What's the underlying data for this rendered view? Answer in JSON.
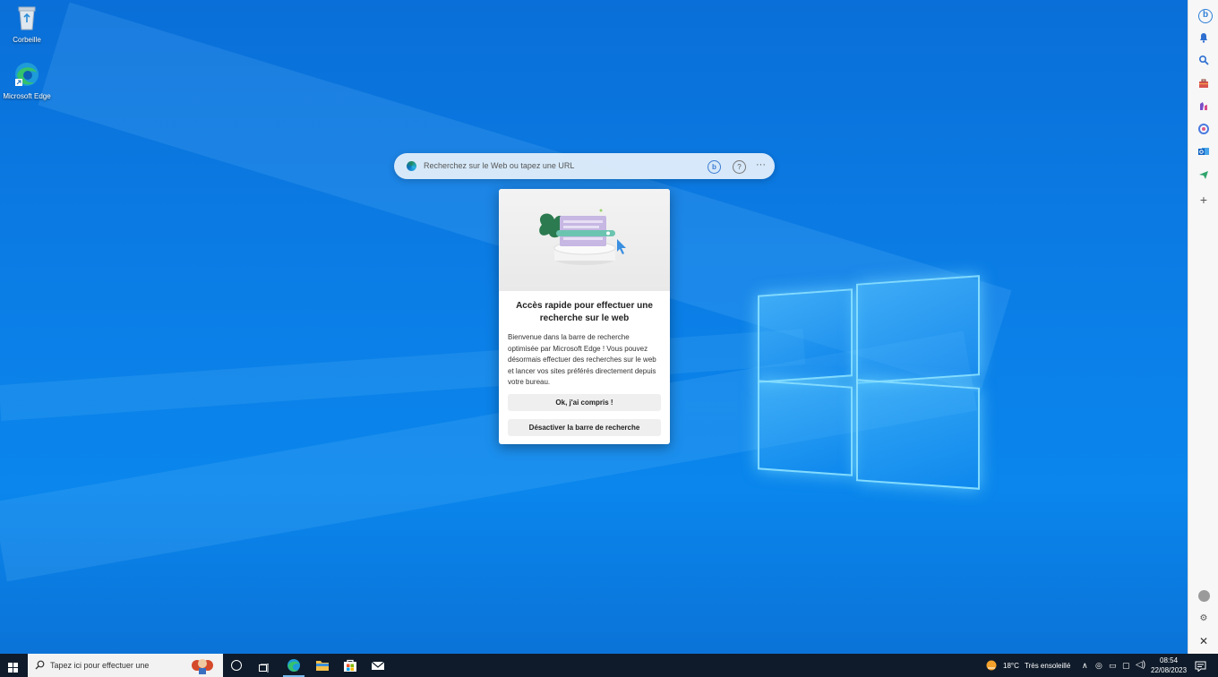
{
  "desktop": {
    "icons": [
      {
        "label": "Corbeille"
      },
      {
        "label": "Microsoft Edge"
      }
    ]
  },
  "searchbar": {
    "placeholder": "Recherchez sur le Web ou tapez une URL"
  },
  "popup": {
    "title": "Accès rapide pour effectuer une recherche sur le web",
    "body": "Bienvenue dans la barre de recherche optimisée par Microsoft Edge ! Vous pouvez désormais effectuer des recherches sur le web et lancer vos sites préférés directement depuis votre bureau.",
    "ok_label": "Ok, j'ai compris !",
    "disable_label": "Désactiver la barre de recherche"
  },
  "taskbar": {
    "search_placeholder": "Tapez ici pour effectuer une",
    "weather_temp": "18°C",
    "weather_text": "Très ensoleillé",
    "time": "08:54",
    "date": "22/08/2023"
  },
  "colors": {
    "taskbar_bg": "#0f1b2a",
    "desktop_blue": "#0b7ee6",
    "popup_bg": "#ffffff"
  }
}
